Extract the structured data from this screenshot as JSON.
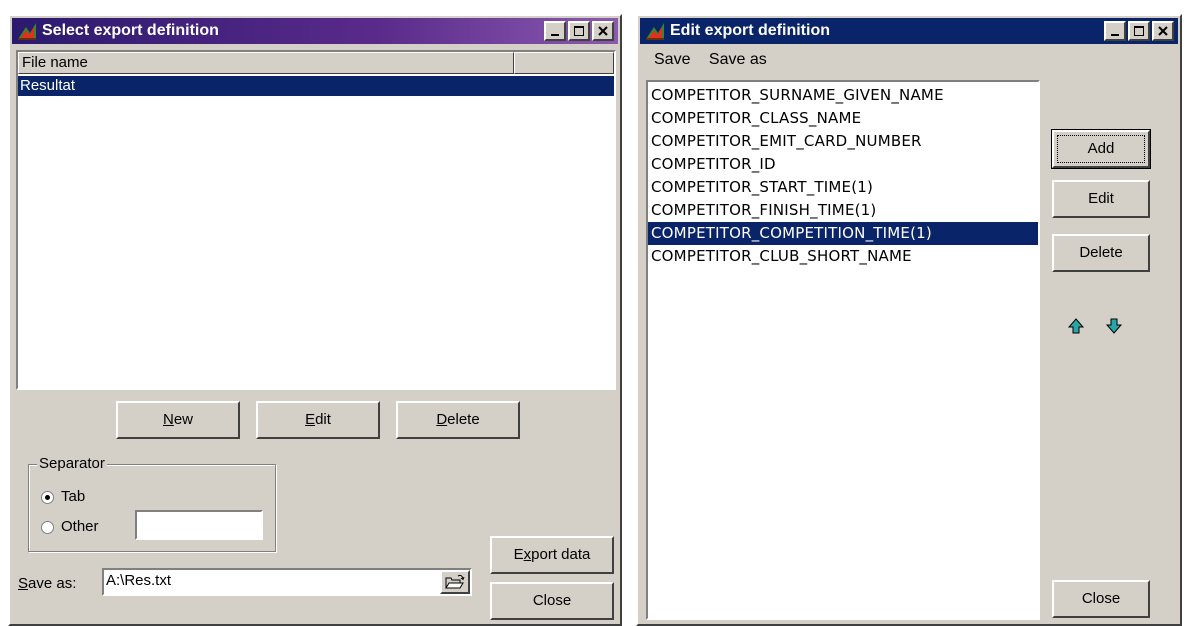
{
  "left_window": {
    "title": "Select export definition",
    "column_header": "File name",
    "files": [
      "Resultat"
    ],
    "buttons": {
      "new": [
        "N",
        "ew"
      ],
      "edit": [
        "E",
        "dit"
      ],
      "delete": [
        "D",
        "elete"
      ]
    },
    "separator": {
      "legend": "Separator",
      "tab_label": "Tab",
      "other_label": "Other",
      "selected": "Tab",
      "other_value": ""
    },
    "save_as": {
      "label_u": "S",
      "label_rest": "ave as:",
      "value": "A:\\Res.txt"
    },
    "export_button": {
      "pre": "E",
      "u": "x",
      "post": "port data"
    },
    "close_button": "Close"
  },
  "right_window": {
    "title": "Edit export definition",
    "menu": [
      "Save",
      "Save as"
    ],
    "fields": [
      "COMPETITOR_SURNAME_GIVEN_NAME",
      "COMPETITOR_CLASS_NAME",
      "COMPETITOR_EMIT_CARD_NUMBER",
      "COMPETITOR_ID",
      "COMPETITOR_START_TIME(1)",
      "COMPETITOR_FINISH_TIME(1)",
      "COMPETITOR_COMPETITION_TIME(1)",
      "COMPETITOR_CLUB_SHORT_NAME"
    ],
    "selected_field_index": 6,
    "buttons": {
      "add": "Add",
      "edit": "Edit",
      "delete": "Delete",
      "close": "Close"
    }
  },
  "colors": {
    "selection": "#0a246a",
    "face": "#d4d0c8",
    "arrow": "#2aa5a5"
  }
}
